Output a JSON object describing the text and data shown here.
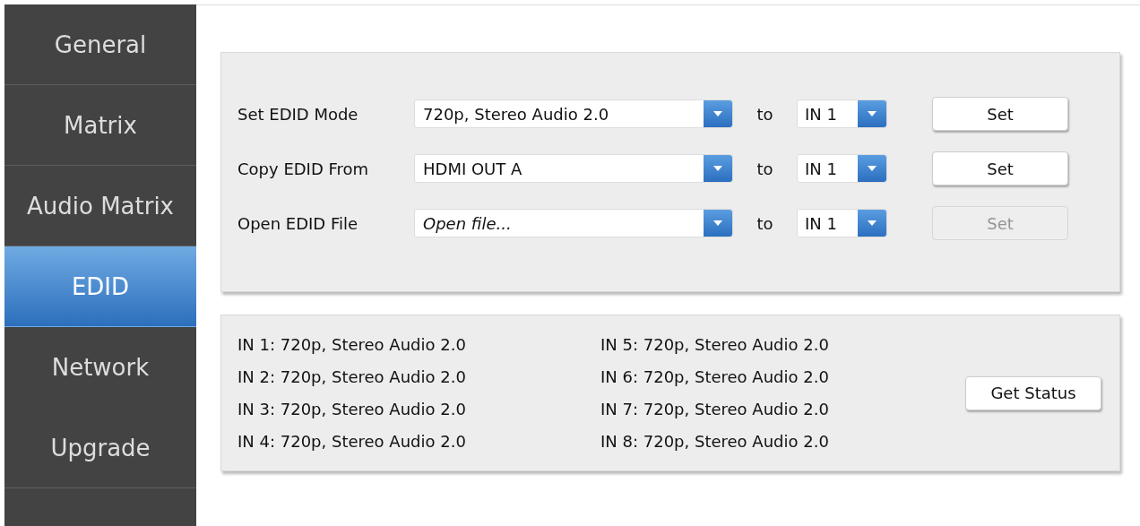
{
  "sidebar": {
    "items": [
      {
        "label": "General",
        "selected": false
      },
      {
        "label": "Matrix",
        "selected": false
      },
      {
        "label": "Audio Matrix",
        "selected": false
      },
      {
        "label": "EDID",
        "selected": true
      },
      {
        "label": "Network",
        "selected": false
      },
      {
        "label": "Upgrade",
        "selected": false
      }
    ]
  },
  "edid_settings": {
    "rows": [
      {
        "label": "Set EDID Mode",
        "source": {
          "value": "720p, Stereo Audio 2.0"
        },
        "to": "to",
        "target": "IN 1",
        "button": {
          "label": "Set",
          "disabled": false
        }
      },
      {
        "label": "Copy EDID From",
        "source": {
          "value": "HDMI OUT A"
        },
        "to": "to",
        "target": "IN 1",
        "button": {
          "label": "Set",
          "disabled": false
        }
      },
      {
        "label": "Open EDID File",
        "source": {
          "placeholder": "Open file..."
        },
        "to": "to",
        "target": "IN 1",
        "button": {
          "label": "Set",
          "disabled": true
        }
      }
    ]
  },
  "status": {
    "lines": [
      "IN 1: 720p, Stereo Audio 2.0",
      "IN 2: 720p, Stereo Audio 2.0",
      "IN 3: 720p, Stereo Audio 2.0",
      "IN 4: 720p, Stereo Audio 2.0",
      "IN 5: 720p, Stereo Audio 2.0",
      "IN 6: 720p, Stereo Audio 2.0",
      "IN 7: 720p, Stereo Audio 2.0",
      "IN 8: 720p, Stereo Audio 2.0"
    ],
    "button": "Get Status"
  }
}
